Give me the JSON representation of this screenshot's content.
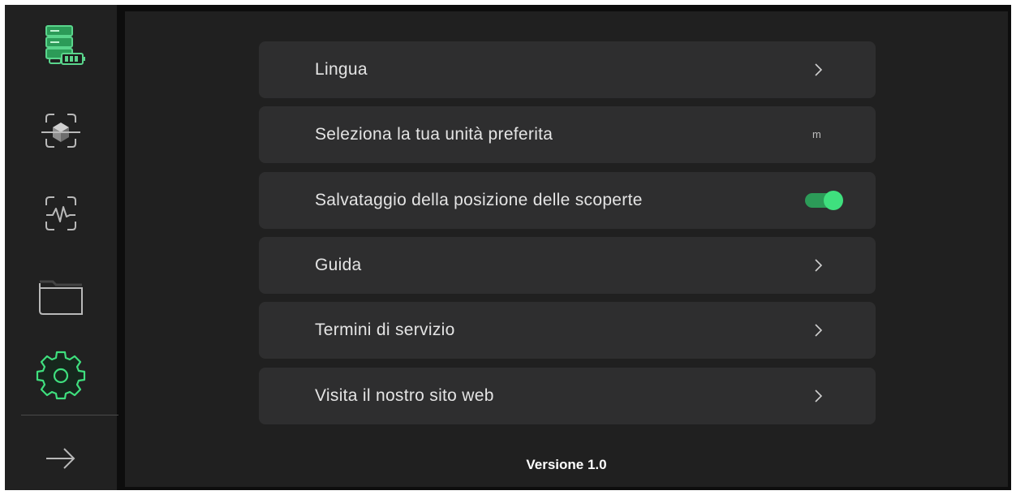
{
  "colors": {
    "accent_green": "#3fe07e",
    "accent_green_dark": "#2c9b58",
    "icon_gray": "#b9b9b9",
    "row_bg": "#2e2e2f",
    "panel_bg": "#202020",
    "sidebar_bg": "#212121"
  },
  "sidebar": {
    "items": [
      {
        "icon": "device-battery-icon",
        "active": false
      },
      {
        "icon": "object-scan-icon",
        "active": false
      },
      {
        "icon": "signal-scan-icon",
        "active": false
      },
      {
        "icon": "folder-icon",
        "active": false
      },
      {
        "icon": "gear-icon",
        "active": true
      }
    ],
    "footer_icon": "arrow-right-icon"
  },
  "settings": {
    "rows": [
      {
        "label": "Lingua",
        "control": "chevron"
      },
      {
        "label": "Seleziona la tua unità preferita",
        "control": "value",
        "value": "m"
      },
      {
        "label": "Salvataggio della posizione delle scoperte",
        "control": "toggle",
        "on": true
      },
      {
        "label": "Guida",
        "control": "chevron"
      },
      {
        "label": "Termini di servizio",
        "control": "chevron"
      },
      {
        "label": "Visita il nostro sito web",
        "control": "chevron"
      }
    ]
  },
  "footer": {
    "version": "Versione 1.0"
  }
}
